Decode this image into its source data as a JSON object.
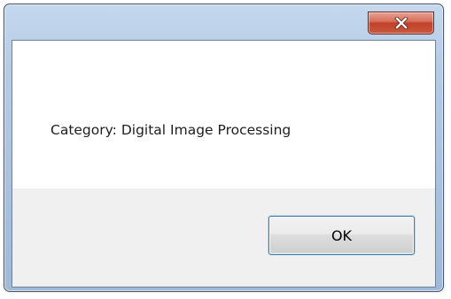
{
  "dialog": {
    "message": "Category: Digital Image Processing",
    "close_icon": "close-x-icon",
    "ok_label": "OK"
  },
  "colors": {
    "close_button": "#c7432b",
    "frame": "#b7cde6",
    "button_area": "#f0f0f0",
    "default_button_border": "#3c7fb1"
  }
}
